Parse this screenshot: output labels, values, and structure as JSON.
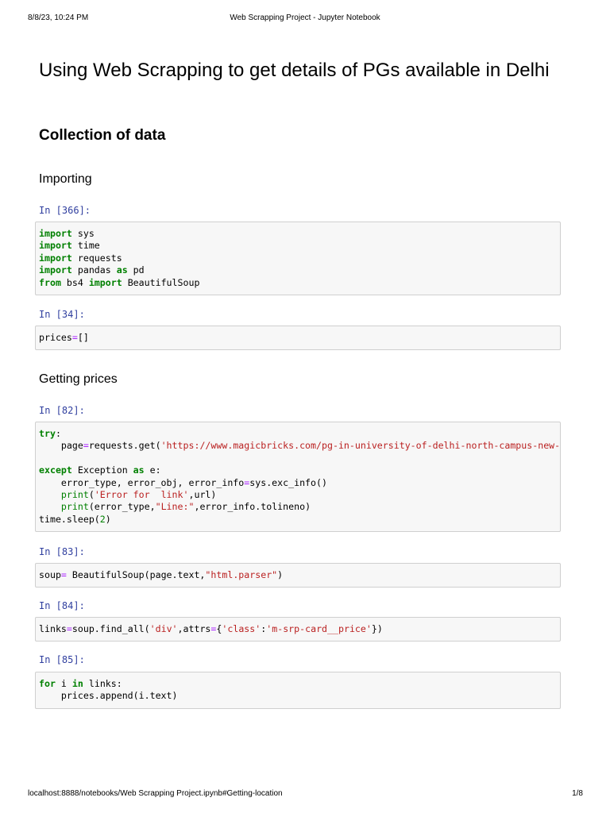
{
  "print_header": {
    "datetime": "8/8/23, 10:24 PM",
    "title": "Web Scrapping Project - Jupyter Notebook"
  },
  "print_footer": {
    "url": "localhost:8888/notebooks/Web Scrapping Project.ipynb#Getting-location",
    "page": "1/8"
  },
  "notebook": {
    "title": "Using Web Scrapping to get details of PGs available in Delhi",
    "section_collection": "Collection of data",
    "section_importing": "Importing",
    "section_prices": "Getting prices",
    "cells": [
      {
        "prompt": "In [366]:"
      },
      {
        "prompt": "In [34]:"
      },
      {
        "prompt": "In [82]:"
      },
      {
        "prompt": "In [83]:"
      },
      {
        "prompt": "In [84]:"
      },
      {
        "prompt": "In [85]:"
      }
    ],
    "code": {
      "c1": {
        "l1_kw": "import",
        "l1_rest": " sys",
        "l2_kw": "import",
        "l2_rest": " time",
        "l3_kw": "import",
        "l3_rest": " requests",
        "l4_kw": "import",
        "l4_mid": " pandas ",
        "l4_as": "as",
        "l4_rest": " pd",
        "l5_kw": "from",
        "l5_mid": " bs4 ",
        "l5_imp": "import",
        "l5_rest": " BeautifulSoup"
      },
      "c2": {
        "a": "prices",
        "eq": "=",
        "b": "[]"
      },
      "c3": {
        "try": "try",
        "colon": ":",
        "l2_a": "    page",
        "l2_eq": "=",
        "l2_b": "requests.get(",
        "l2_str": "'https://www.magicbricks.com/pg-in-university-of-delhi-north-campus-new-delhi-pppfr'",
        "except": "except",
        "l4_mid": " Exception ",
        "as": "as",
        "l4_rest": " e:",
        "l5_a": "    error_type, error_obj, error_info",
        "l5_eq": "=",
        "l5_b": "sys.exc_info()",
        "l6_ind": "    ",
        "l6_print": "print",
        "l6_open": "(",
        "l6_str": "'Error for  link'",
        "l6_rest": ",url)",
        "l7_ind": "    ",
        "l7_print": "print",
        "l7_open": "(error_type,",
        "l7_str": "\"Line:\"",
        "l7_rest": ",error_info.tolineno)",
        "l8_a": "time.sleep(",
        "l8_num": "2",
        "l8_b": ")"
      },
      "c4": {
        "a": "soup",
        "eq": "=",
        "b": " BeautifulSoup(page.text,",
        "str": "\"html.parser\"",
        "c": ")"
      },
      "c5": {
        "a": "links",
        "eq": "=",
        "b": "soup.find_all(",
        "s1": "'div'",
        "c": ",attrs",
        "eq2": "=",
        "d": "{",
        "s2": "'class'",
        "e": ":",
        "s3": "'m-srp-card__price'",
        "f": "})"
      },
      "c6": {
        "for": "for",
        "l1_mid": " i ",
        "in": "in",
        "l1_rest": " links:",
        "l2": "    prices.append(i.text)"
      }
    }
  }
}
